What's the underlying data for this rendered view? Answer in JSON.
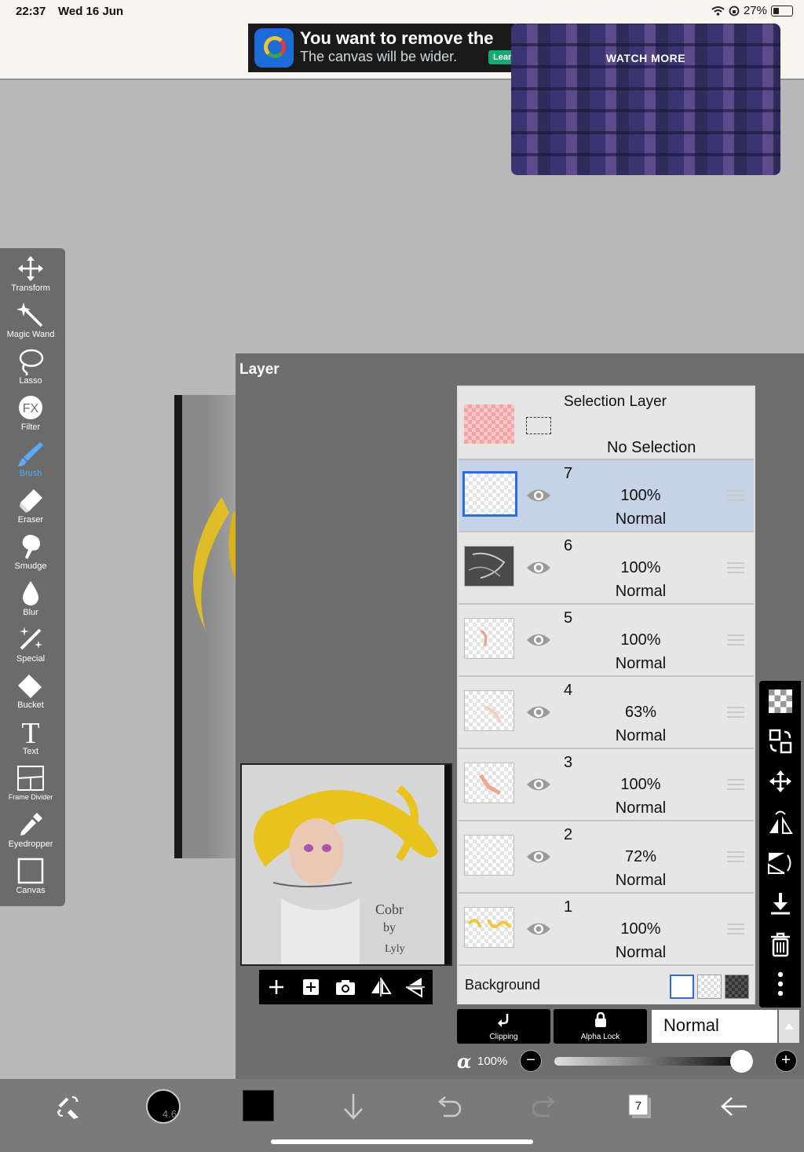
{
  "status_bar": {
    "time": "22:37",
    "date": "Wed 16 Jun",
    "battery": "27%"
  },
  "ad": {
    "headline": "You want to remove the",
    "subline": "The canvas will be wider.",
    "cta": "Lear",
    "video_cta": "WATCH MORE"
  },
  "toolbar": {
    "items": [
      {
        "label": "Transform",
        "icon": "move-icon"
      },
      {
        "label": "Magic Wand",
        "icon": "magic-wand-icon"
      },
      {
        "label": "Lasso",
        "icon": "lasso-icon"
      },
      {
        "label": "Filter",
        "icon": "fx-icon",
        "glyph": "FX"
      },
      {
        "label": "Brush",
        "icon": "brush-icon",
        "active": true
      },
      {
        "label": "Eraser",
        "icon": "eraser-icon"
      },
      {
        "label": "Smudge",
        "icon": "smudge-icon"
      },
      {
        "label": "Blur",
        "icon": "blur-drop-icon"
      },
      {
        "label": "Special",
        "icon": "special-icon"
      },
      {
        "label": "Bucket",
        "icon": "bucket-icon"
      },
      {
        "label": "Text",
        "icon": "text-icon",
        "glyph": "T"
      },
      {
        "label": "Frame Divider",
        "icon": "frame-divider-icon"
      },
      {
        "label": "Eyedropper",
        "icon": "eyedropper-icon"
      },
      {
        "label": "Canvas",
        "icon": "canvas-icon"
      }
    ]
  },
  "layer_panel": {
    "title": "Layer",
    "selection_layer": {
      "name": "Selection Layer",
      "status": "No Selection"
    },
    "layers": [
      {
        "number": "7",
        "opacity": "100%",
        "blend": "Normal",
        "selected": true
      },
      {
        "number": "6",
        "opacity": "100%",
        "blend": "Normal",
        "selected": false
      },
      {
        "number": "5",
        "opacity": "100%",
        "blend": "Normal",
        "selected": false
      },
      {
        "number": "4",
        "opacity": "63%",
        "blend": "Normal",
        "selected": false
      },
      {
        "number": "3",
        "opacity": "100%",
        "blend": "Normal",
        "selected": false
      },
      {
        "number": "2",
        "opacity": "72%",
        "blend": "Normal",
        "selected": false
      },
      {
        "number": "1",
        "opacity": "100%",
        "blend": "Normal",
        "selected": false
      }
    ],
    "background_label": "Background",
    "clipping_label": "Clipping",
    "alpha_lock_label": "Alpha Lock",
    "blend_mode": "Normal",
    "alpha_symbol": "α",
    "alpha_value": "100%",
    "alpha_level": 0.95
  },
  "bottom_bar": {
    "brush_size": "4.6",
    "layer_count_badge": "7",
    "brush_color": "#000000"
  },
  "colors": {
    "accent_blue": "#2e6ae0",
    "selected_row": "#c6d3e6",
    "active_tool": "#5aaaf5"
  }
}
